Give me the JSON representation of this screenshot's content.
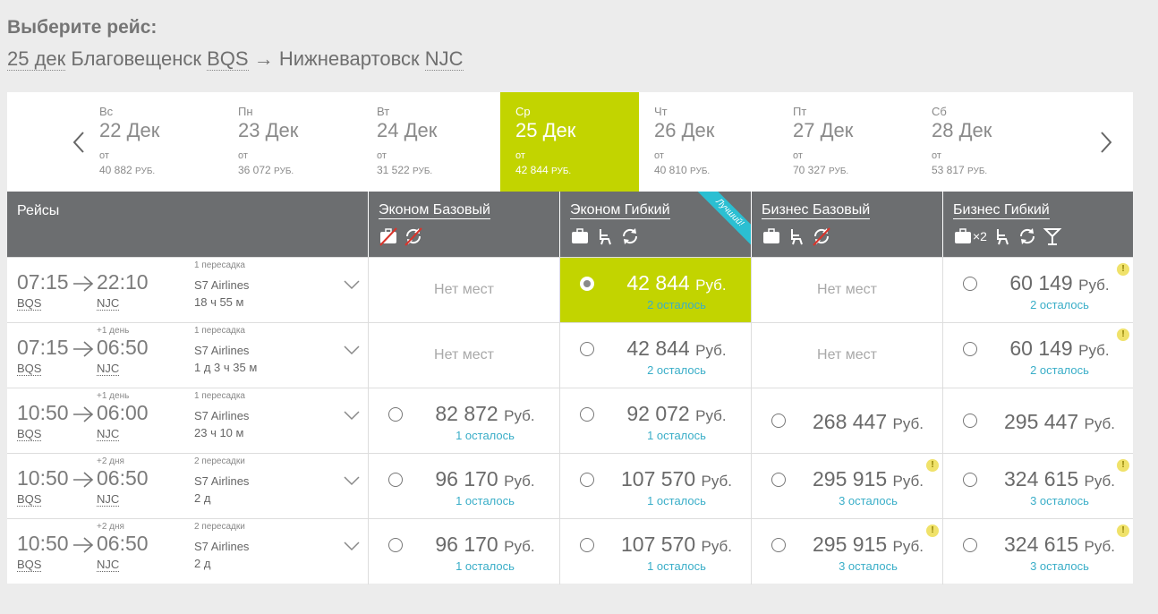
{
  "header": {
    "title": "Выберите рейс:",
    "route_date": "25 дек",
    "route_from_city": "Благовещенск",
    "route_from_code": "BQS",
    "route_arrow": "→",
    "route_to_city": "Нижневартовск",
    "route_to_code": "NJC"
  },
  "dates": [
    {
      "dow": "Вс",
      "date": "22 Дек",
      "ot": "от",
      "price": "40 882",
      "cur": "РУБ."
    },
    {
      "dow": "Пн",
      "date": "23 Дек",
      "ot": "от",
      "price": "36 072",
      "cur": "РУБ."
    },
    {
      "dow": "Вт",
      "date": "24 Дек",
      "ot": "от",
      "price": "31 522",
      "cur": "РУБ."
    },
    {
      "dow": "Ср",
      "date": "25 Дек",
      "ot": "от",
      "price": "42 844",
      "cur": "РУБ.",
      "active": true
    },
    {
      "dow": "Чт",
      "date": "26 Дек",
      "ot": "от",
      "price": "40 810",
      "cur": "РУБ."
    },
    {
      "dow": "Пт",
      "date": "27 Дек",
      "ot": "от",
      "price": "70 327",
      "cur": "РУБ."
    },
    {
      "dow": "Сб",
      "date": "28 Дек",
      "ot": "от",
      "price": "53 817",
      "cur": "РУБ."
    }
  ],
  "table_header": {
    "flights": "Рейсы",
    "fares": [
      "Эконом Базовый",
      "Эконом Гибкий",
      "Бизнес Базовый",
      "Бизнес Гибкий"
    ],
    "best_ribbon": "Лучший!",
    "baggage_x2": "×2"
  },
  "rows": [
    {
      "dep_time": "07:15",
      "dep_code": "BQS",
      "arr_time": "22:10",
      "arr_code": "NJC",
      "plus_days": "",
      "stops": "1 пересадка",
      "airline": "S7 Airlines",
      "duration": "18 ч 55 м",
      "fares": [
        {
          "none": "Нет мест"
        },
        {
          "amount": "42 844",
          "cur": "Руб.",
          "left": "2 осталось",
          "selected": true
        },
        {
          "none": "Нет мест"
        },
        {
          "amount": "60 149",
          "cur": "Руб.",
          "left": "2 осталось",
          "warn": "!"
        }
      ]
    },
    {
      "dep_time": "07:15",
      "dep_code": "BQS",
      "arr_time": "06:50",
      "arr_code": "NJC",
      "plus_days": "+1 день",
      "stops": "1 пересадка",
      "airline": "S7 Airlines",
      "duration": "1 д 3 ч 35 м",
      "fares": [
        {
          "none": "Нет мест"
        },
        {
          "amount": "42 844",
          "cur": "Руб.",
          "left": "2 осталось"
        },
        {
          "none": "Нет мест"
        },
        {
          "amount": "60 149",
          "cur": "Руб.",
          "left": "2 осталось",
          "warn": "!"
        }
      ]
    },
    {
      "dep_time": "10:50",
      "dep_code": "BQS",
      "arr_time": "06:00",
      "arr_code": "NJC",
      "plus_days": "+1 день",
      "stops": "1 пересадка",
      "airline": "S7 Airlines",
      "duration": "23 ч 10 м",
      "fares": [
        {
          "amount": "82 872",
          "cur": "Руб.",
          "left": "1 осталось"
        },
        {
          "amount": "92 072",
          "cur": "Руб.",
          "left": "1 осталось"
        },
        {
          "amount": "268 447",
          "cur": "Руб.",
          "left": ""
        },
        {
          "amount": "295 447",
          "cur": "Руб.",
          "left": ""
        }
      ]
    },
    {
      "dep_time": "10:50",
      "dep_code": "BQS",
      "arr_time": "06:50",
      "arr_code": "NJC",
      "plus_days": "+2 дня",
      "stops": "2 пересадки",
      "airline": "S7 Airlines",
      "duration": "2 д",
      "fares": [
        {
          "amount": "96 170",
          "cur": "Руб.",
          "left": "1 осталось"
        },
        {
          "amount": "107 570",
          "cur": "Руб.",
          "left": "1 осталось"
        },
        {
          "amount": "295 915",
          "cur": "Руб.",
          "left": "3 осталось",
          "warn": "!"
        },
        {
          "amount": "324 615",
          "cur": "Руб.",
          "left": "3 осталось",
          "warn": "!"
        }
      ]
    },
    {
      "dep_time": "10:50",
      "dep_code": "BQS",
      "arr_time": "06:50",
      "arr_code": "NJC",
      "plus_days": "+2 дня",
      "stops": "2 пересадки",
      "airline": "S7 Airlines",
      "duration": "2 д",
      "fares": [
        {
          "amount": "96 170",
          "cur": "Руб.",
          "left": "1 осталось"
        },
        {
          "amount": "107 570",
          "cur": "Руб.",
          "left": "1 осталось"
        },
        {
          "amount": "295 915",
          "cur": "Руб.",
          "left": "3 осталось",
          "warn": "!"
        },
        {
          "amount": "324 615",
          "cur": "Руб.",
          "left": "3 осталось",
          "warn": "!"
        }
      ]
    }
  ],
  "colors": {
    "accent": "#c2d400",
    "header_bg": "#6c6e70",
    "link": "#3aaec8",
    "ribbon": "#2bbfd2"
  }
}
